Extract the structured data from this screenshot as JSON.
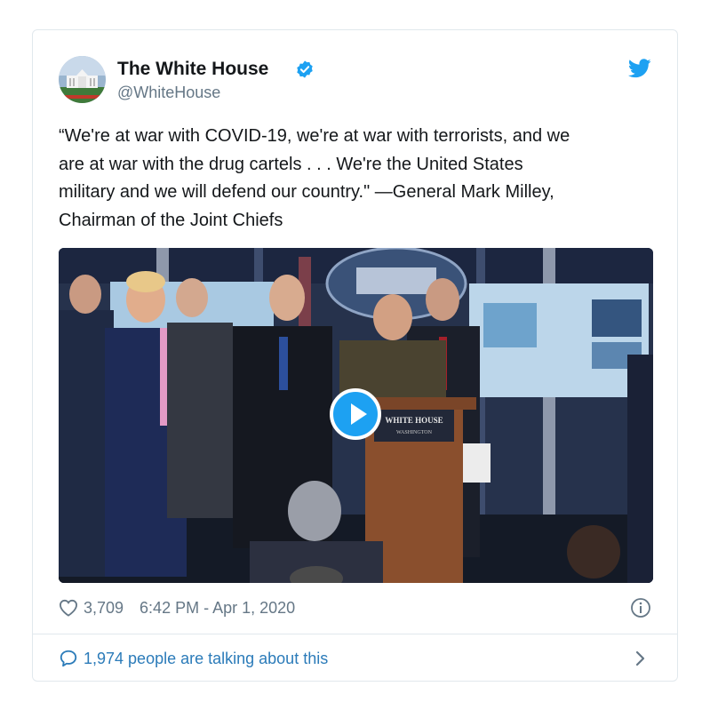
{
  "account": {
    "name": "The White House",
    "handle": "@WhiteHouse"
  },
  "tweet": {
    "text": "“We're at war with COVID-19, we're at war with terrorists, and we\nare at war with the drug cartels . . . We're the United States\nmilitary and we will defend our country.\" —General Mark Milley,\nChairman of the Joint Chiefs"
  },
  "media": {
    "podium_sign_line1": "WHITE HOUSE",
    "podium_sign_line2": "WASHINGTON"
  },
  "stats": {
    "likes": "3,709",
    "timestamp": "6:42 PM - Apr 1, 2020"
  },
  "conversation": {
    "label": "1,974 people are talking about this"
  },
  "icons": {
    "verified": "verified-badge-icon",
    "brand": "twitter-bird-icon",
    "like": "heart-icon",
    "info": "info-icon",
    "reply": "speech-bubble-icon",
    "chevron": "chevron-right-icon",
    "play": "play-icon"
  },
  "colors": {
    "brand_blue": "#1da1f2",
    "link_blue": "#2b7bb9",
    "muted_gray": "#657786",
    "border": "#e1e8ed",
    "text": "#14171a"
  }
}
